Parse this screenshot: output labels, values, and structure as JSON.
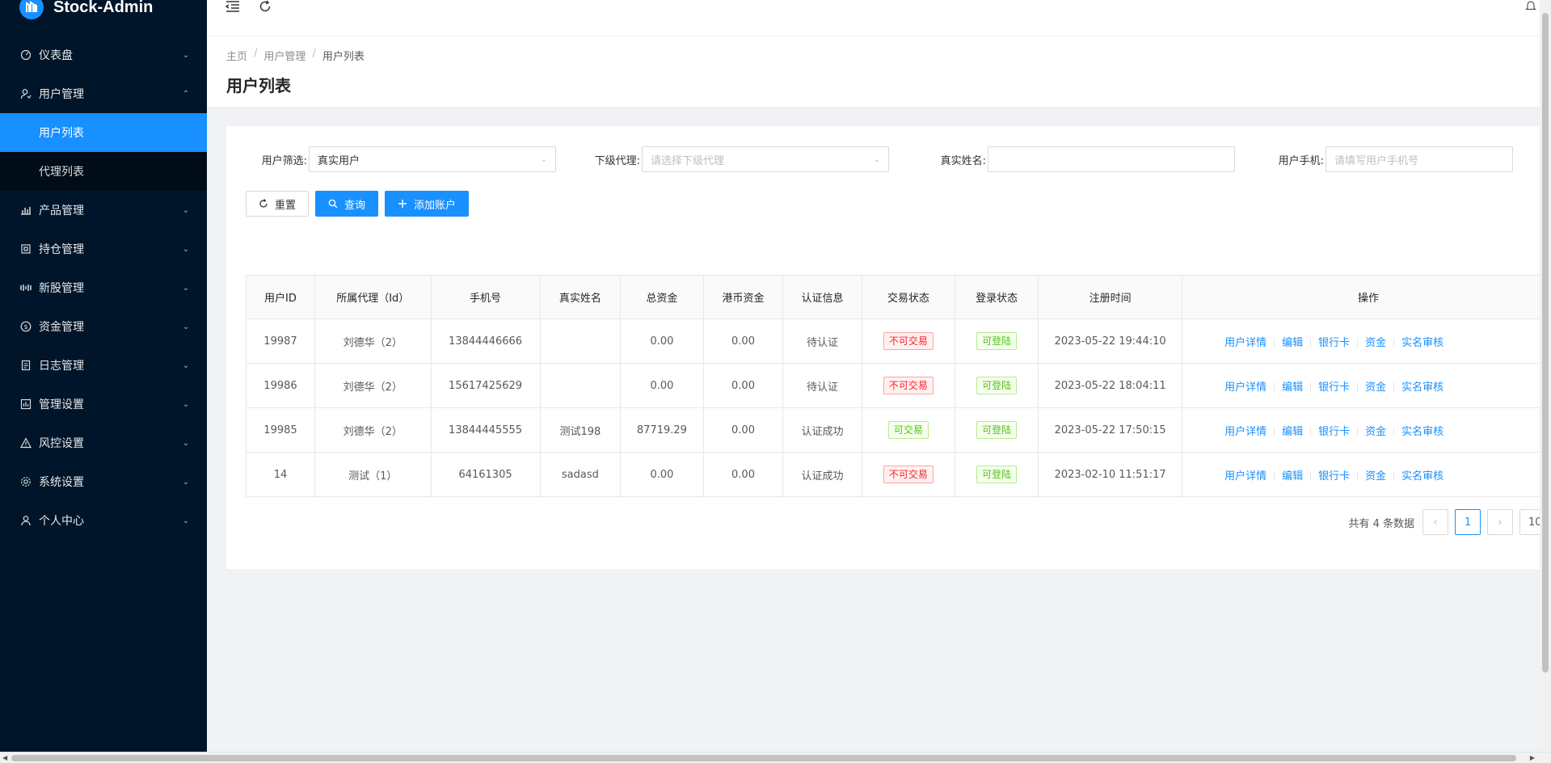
{
  "app": {
    "title": "Stock-Admin"
  },
  "sidebar": {
    "items": [
      {
        "label": "仪表盘",
        "icon": "dashboard-icon",
        "expanded": false
      },
      {
        "label": "用户管理",
        "icon": "user-manage-icon",
        "expanded": true,
        "children": [
          {
            "label": "用户列表",
            "active": true
          },
          {
            "label": "代理列表",
            "active": false
          }
        ]
      },
      {
        "label": "产品管理",
        "icon": "chart-icon",
        "expanded": false
      },
      {
        "label": "持仓管理",
        "icon": "position-icon",
        "expanded": false
      },
      {
        "label": "新股管理",
        "icon": "ipo-icon",
        "expanded": false
      },
      {
        "label": "资金管理",
        "icon": "money-icon",
        "expanded": false
      },
      {
        "label": "日志管理",
        "icon": "log-icon",
        "expanded": false
      },
      {
        "label": "管理设置",
        "icon": "admin-settings-icon",
        "expanded": false
      },
      {
        "label": "风控设置",
        "icon": "warning-icon",
        "expanded": false
      },
      {
        "label": "系统设置",
        "icon": "gear-icon",
        "expanded": false
      },
      {
        "label": "个人中心",
        "icon": "person-icon",
        "expanded": false
      }
    ]
  },
  "topbar": {
    "collapse_icon": "menu-fold-icon",
    "refresh_icon": "refresh-icon",
    "bell_icon": "bell-icon"
  },
  "breadcrumb": [
    "主页",
    "用户管理",
    "用户列表"
  ],
  "page": {
    "title": "用户列表"
  },
  "filters": {
    "user_filter": {
      "label": "用户筛选:",
      "value": "真实用户"
    },
    "sub_agent": {
      "label": "下级代理:",
      "placeholder": "请选择下级代理"
    },
    "real_name": {
      "label": "真实姓名:",
      "value": ""
    },
    "phone": {
      "label": "用户手机:",
      "placeholder": "请填写用户手机号"
    }
  },
  "buttons": {
    "reset": "重置",
    "query": "查询",
    "add": "添加账户"
  },
  "table": {
    "headers": [
      "用户ID",
      "所属代理（Id）",
      "手机号",
      "真实姓名",
      "总资金",
      "港币资金",
      "认证信息",
      "交易状态",
      "登录状态",
      "注册时间",
      "操作"
    ],
    "rows": [
      {
        "id": "19987",
        "agent": "刘德华（2）",
        "phone": "13844446666",
        "name": "",
        "total": "0.00",
        "hkd": "0.00",
        "auth": "待认证",
        "trade": "不可交易",
        "trade_ok": false,
        "login": "可登陆",
        "time": "2023-05-22 19:44:10"
      },
      {
        "id": "19986",
        "agent": "刘德华（2）",
        "phone": "15617425629",
        "name": "",
        "total": "0.00",
        "hkd": "0.00",
        "auth": "待认证",
        "trade": "不可交易",
        "trade_ok": false,
        "login": "可登陆",
        "time": "2023-05-22 18:04:11"
      },
      {
        "id": "19985",
        "agent": "刘德华（2）",
        "phone": "13844445555",
        "name": "测试198",
        "total": "87719.29",
        "hkd": "0.00",
        "auth": "认证成功",
        "trade": "可交易",
        "trade_ok": true,
        "login": "可登陆",
        "time": "2023-05-22 17:50:15"
      },
      {
        "id": "14",
        "agent": "测试（1）",
        "phone": "64161305",
        "name": "sadasd",
        "total": "0.00",
        "hkd": "0.00",
        "auth": "认证成功",
        "trade": "不可交易",
        "trade_ok": false,
        "login": "可登陆",
        "time": "2023-02-10 11:51:17"
      }
    ],
    "ops": [
      "用户详情",
      "编辑",
      "银行卡",
      "资金",
      "实名审核"
    ]
  },
  "pagination": {
    "total_text": "共有 4 条数据",
    "current": "1",
    "page_size": "10"
  },
  "colors": {
    "sidebar_bg": "#001529",
    "accent": "#1890ff",
    "danger": "#f5222d",
    "success": "#52c41a"
  }
}
